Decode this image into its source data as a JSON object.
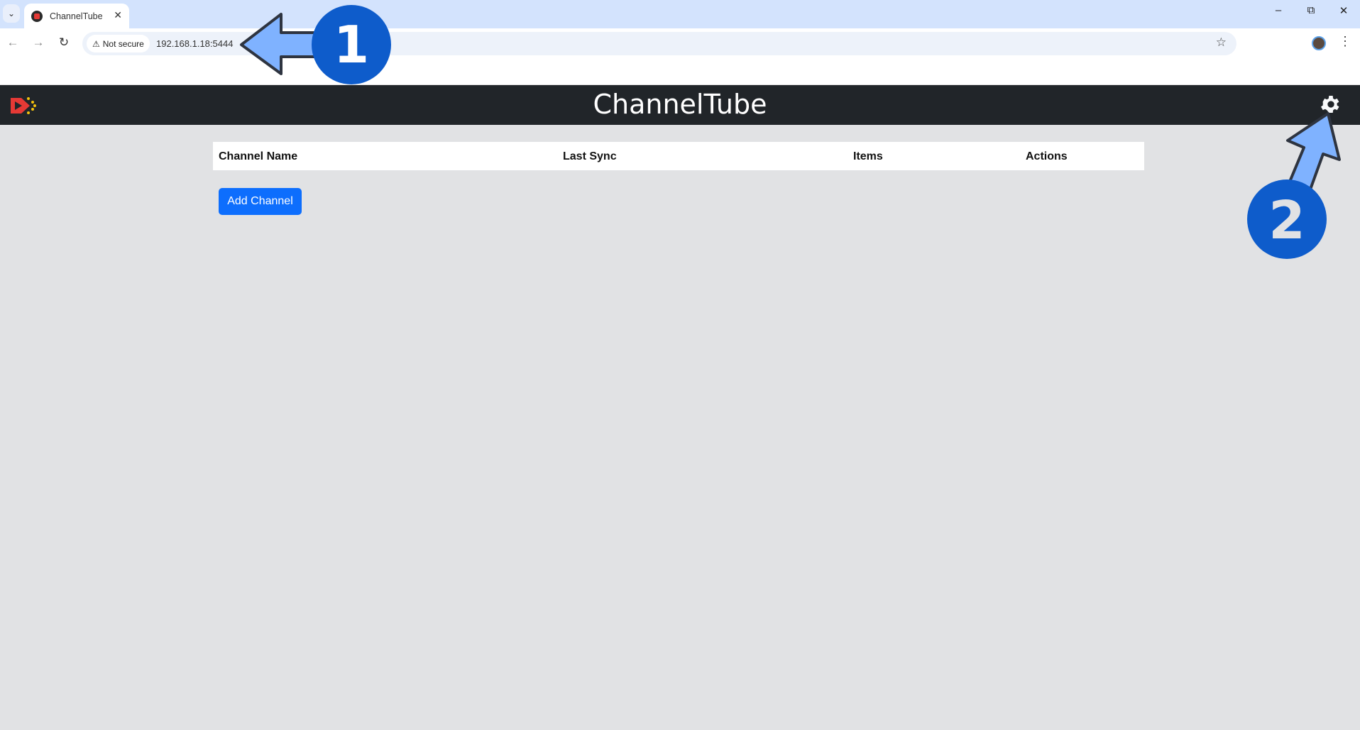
{
  "browser": {
    "tab_title": "ChannelTube",
    "security_label": "Not secure",
    "url": "192.168.1.18:5444"
  },
  "app": {
    "title": "ChannelTube",
    "table_headers": [
      "Channel Name",
      "Last Sync",
      "Items",
      "Actions"
    ],
    "add_channel_label": "Add Channel",
    "primary_color": "#0d6efd",
    "header_color": "#212529"
  },
  "annotations": {
    "step1": "1",
    "step2": "2",
    "arrow_color": "#7fb2ff",
    "badge_color": "#0e5ccb"
  },
  "icons": [
    "chevron-down-icon",
    "close-icon",
    "back-icon",
    "forward-icon",
    "reload-icon",
    "warning-icon",
    "star-icon",
    "avatar",
    "kebab-menu-icon",
    "channeltube-logo",
    "gear-icon"
  ]
}
